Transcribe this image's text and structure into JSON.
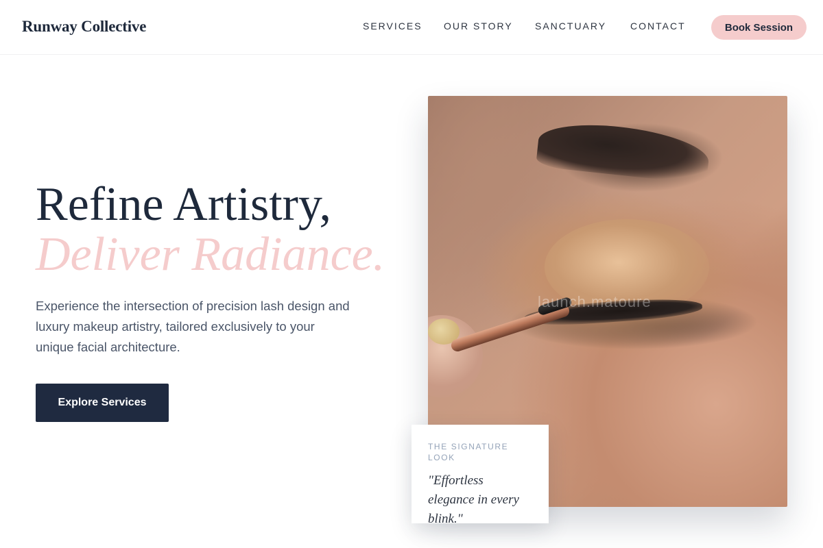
{
  "header": {
    "brand": "Runway Collective",
    "nav": [
      {
        "label": "SERVICES"
      },
      {
        "label": "OUR STORY"
      },
      {
        "label": "SANCTUARY"
      },
      {
        "label": "CONTACT"
      }
    ],
    "cta_label": "Book Session"
  },
  "hero": {
    "title_line1": "Refine Artistry,",
    "title_line2": "Deliver Radiance.",
    "description": "Experience the intersection of precision lash design and luxury makeup artistry, tailored exclusively to your unique facial architecture.",
    "cta_label": "Explore Services"
  },
  "image": {
    "watermark": "launch.matoure"
  },
  "signature_card": {
    "label": "THE SIGNATURE LOOK",
    "quote": "\"Effortless elegance in every blink.\""
  },
  "colors": {
    "navy": "#1e293b",
    "accent_pink": "#f5cccc",
    "button_dark": "#1f2a40",
    "muted_text": "#4a5568"
  }
}
